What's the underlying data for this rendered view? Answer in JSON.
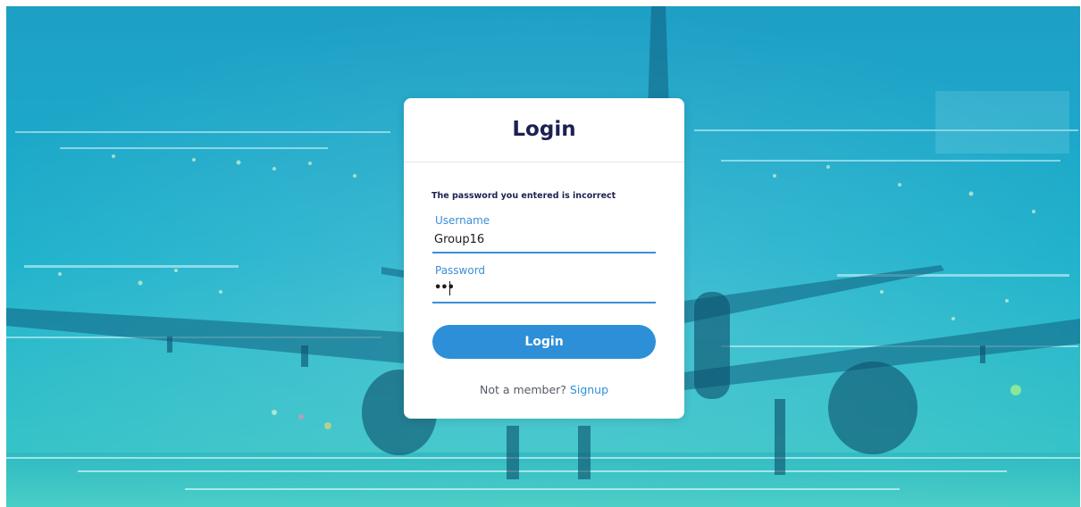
{
  "background": {
    "scene": "airplane-on-runway-at-night",
    "tint_color": "#1aa6c8"
  },
  "login_card": {
    "title": "Login",
    "error_message": "The password you entered is incorrect",
    "username": {
      "label": "Username",
      "value": "Group16"
    },
    "password": {
      "label": "Password",
      "value": "•••"
    },
    "submit_label": "Login",
    "signup_prompt": "Not a member?",
    "signup_link": "Signup"
  },
  "colors": {
    "accent": "#2d8fd8",
    "title_text": "#1c2150",
    "label_text": "#3b8ed6"
  }
}
